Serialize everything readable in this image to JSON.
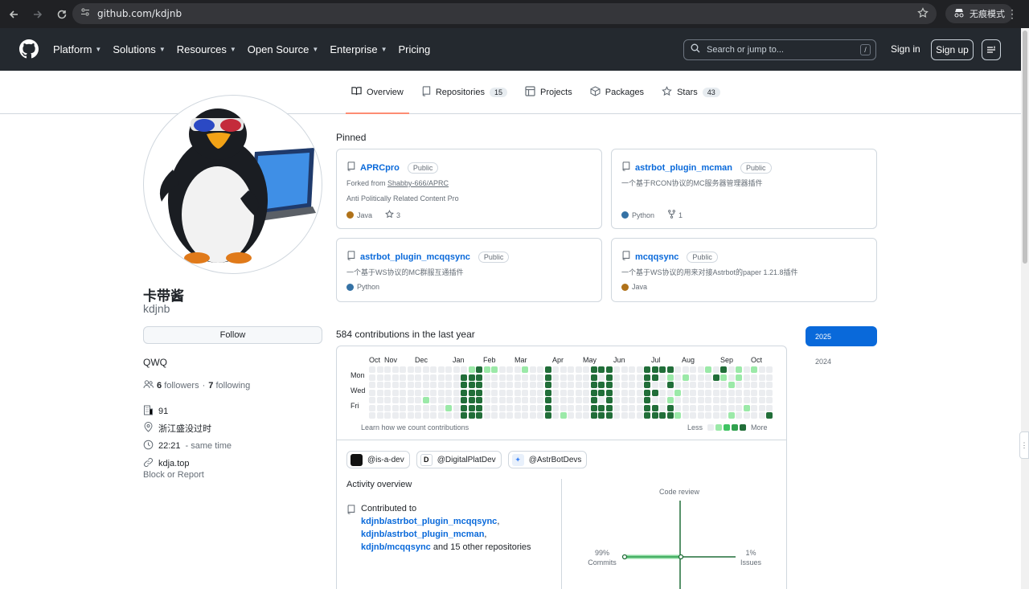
{
  "browser": {
    "url": "github.com/kdjnb",
    "incognito_label": "无痕模式"
  },
  "header": {
    "nav": [
      "Platform",
      "Solutions",
      "Resources",
      "Open Source",
      "Enterprise",
      "Pricing"
    ],
    "search_placeholder": "Search or jump to...",
    "search_shortcut": "/",
    "sign_in": "Sign in",
    "sign_up": "Sign up"
  },
  "tabs": [
    {
      "label": "Overview",
      "count": "",
      "icon": "book-icon",
      "active": true
    },
    {
      "label": "Repositories",
      "count": "15",
      "icon": "repo-icon",
      "active": false
    },
    {
      "label": "Projects",
      "count": "",
      "icon": "table-icon",
      "active": false
    },
    {
      "label": "Packages",
      "count": "",
      "icon": "package-icon",
      "active": false
    },
    {
      "label": "Stars",
      "count": "43",
      "icon": "star-icon",
      "active": false
    }
  ],
  "profile": {
    "name": "卡带酱",
    "login": "kdjnb",
    "follow_label": "Follow",
    "bio": "QWQ",
    "followers_count": "6",
    "followers_label": "followers",
    "following_sep": " · ",
    "following_count": "7",
    "following_label": "following",
    "company": "91",
    "location": "浙江盛没过时",
    "local_time": "22:21",
    "time_note": "- same time",
    "website": "kdja.top",
    "block_report": "Block or Report"
  },
  "pinned": {
    "title": "Pinned",
    "repos": [
      {
        "name": "APRCpro",
        "visibility": "Public",
        "fork_prefix": "Forked from ",
        "fork_source": "Shabby-666/APRC",
        "description": "Anti Politically Related Content Pro",
        "language": "Java",
        "lang_color": "#b07219",
        "stars": "3",
        "forks": ""
      },
      {
        "name": "astrbot_plugin_mcman",
        "visibility": "Public",
        "fork_prefix": "",
        "fork_source": "",
        "description": "一个基于RCON协议的MC服务器管理器插件",
        "language": "Python",
        "lang_color": "#3572A5",
        "stars": "",
        "forks": "1"
      },
      {
        "name": "astrbot_plugin_mcqqsync",
        "visibility": "Public",
        "fork_prefix": "",
        "fork_source": "",
        "description": "一个基于WS协议的MC群服互通插件",
        "language": "Python",
        "lang_color": "#3572A5",
        "stars": "",
        "forks": ""
      },
      {
        "name": "mcqqsync",
        "visibility": "Public",
        "fork_prefix": "",
        "fork_source": "",
        "description": "一个基于WS协议的用来对接Astrbot的paper 1.21.8插件",
        "language": "Java",
        "lang_color": "#b07219",
        "stars": "",
        "forks": ""
      }
    ]
  },
  "contributions": {
    "title": "584 contributions in the last year",
    "months": [
      "Oct",
      "Nov",
      "Dec",
      "Jan",
      "Feb",
      "Mar",
      "Apr",
      "May",
      "Jun",
      "Jul",
      "Aug",
      "Sep",
      "Oct"
    ],
    "days": [
      "Mon",
      "Wed",
      "Fri"
    ],
    "learn_link": "Learn how we count contributions",
    "legend_less": "Less",
    "legend_more": "More",
    "colors": [
      "#ebedf0",
      "#9be9a8",
      "#40c463",
      "#30a14e",
      "#216e39"
    ]
  },
  "orgs": [
    {
      "handle": "@is-a-dev",
      "icon": "is-a-dev-logo"
    },
    {
      "handle": "@DigitalPlatDev",
      "icon": "digitalplat-logo"
    },
    {
      "handle": "@AstrBotDevs",
      "icon": "astrbot-logo"
    }
  ],
  "activity": {
    "title": "Activity overview",
    "contributed_prefix": "Contributed to ",
    "repo1": "kdjnb/astrbot_plugin_mcqqsync",
    "sep1": ", ",
    "repo2": "kdjnb/astrbot_plugin_mcman",
    "sep2": ",",
    "repo3": "kdjnb/mcqqsync",
    "suffix": " and 15 other repositories",
    "radar": {
      "code_review_label": "Code review",
      "commits_pct": "99%",
      "commits_label": "Commits",
      "issues_pct": "1%",
      "issues_label": "Issues"
    }
  },
  "years": [
    "2025",
    "2024"
  ]
}
